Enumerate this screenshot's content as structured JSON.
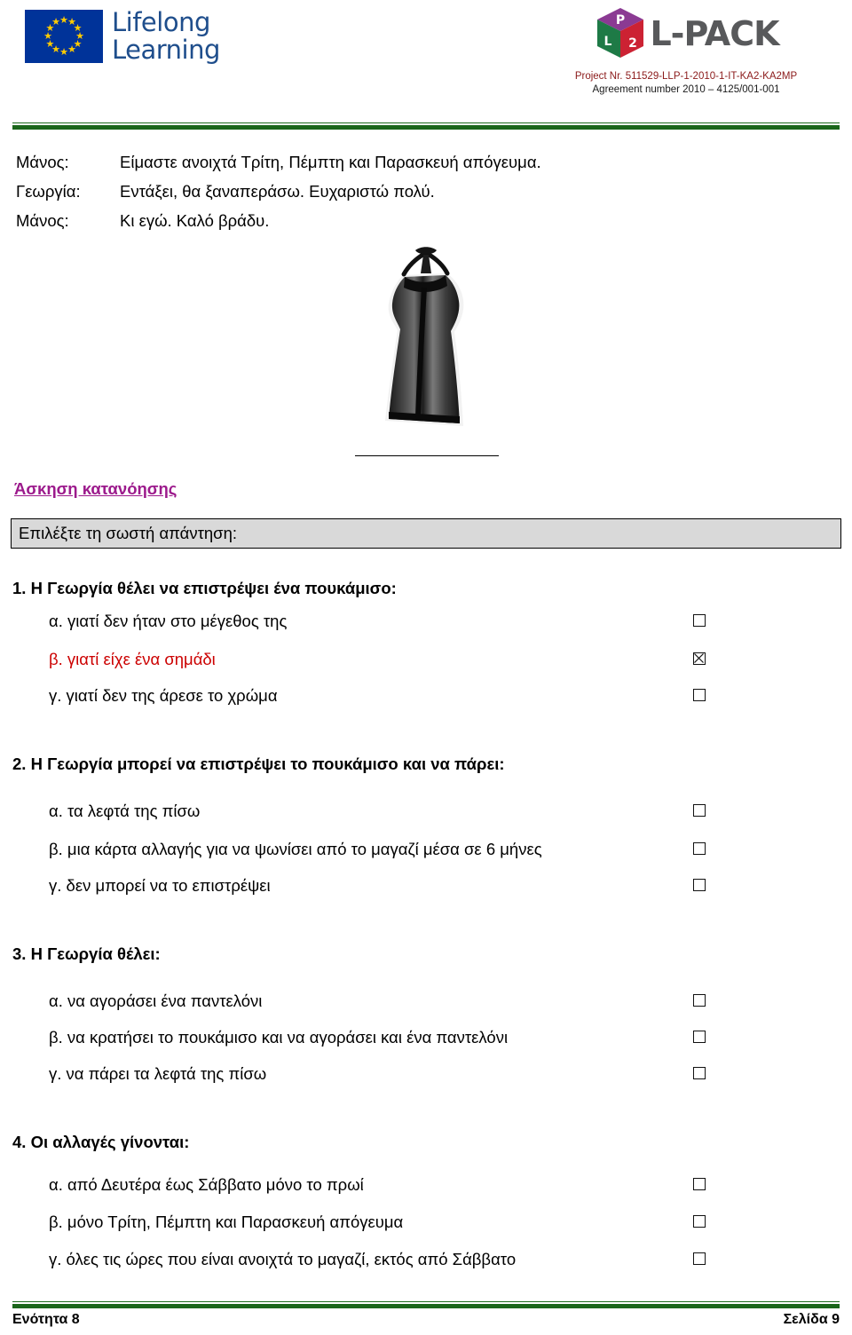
{
  "header": {
    "eu_logo_line1": "Lifelong",
    "eu_logo_line2": "Learning",
    "lpack_word": "L-PACK",
    "cube_top_letter": "P",
    "cube_left_letter": "L",
    "cube_right_letter": "2",
    "project_line1": "Project Nr. 511529-LLP-1-2010-1-IT-KA2-KA2MP",
    "project_line2": "Agreement number 2010 – 4125/001-001",
    "rule_color": "#1A661A"
  },
  "dialogue": [
    {
      "speaker": "Μάνος:",
      "text": "Είμαστε ανοιχτά Τρίτη, Πέμπτη και Παρασκευή απόγευμα."
    },
    {
      "speaker": "Γεωργία:",
      "text": "Εντάξει, θα ξαναπεράσω. Ευχαριστώ πολύ."
    },
    {
      "speaker": "Μάνος:",
      "text": "Κι εγώ. Καλό βράδυ."
    }
  ],
  "illustration": {
    "alt": "black-halter-dress"
  },
  "exercise": {
    "title": "Άσκηση κατανόησης",
    "title_color": "#9C1A8C",
    "instruction": "Επιλέξτε τη σωστή απάντηση:",
    "correct_color": "#CC0000"
  },
  "questions": [
    {
      "number": "1.",
      "title": "1. Η Γεωργία θέλει να επιστρέψει ένα πουκάμισο:",
      "options": [
        {
          "label": "α. γιατί δεν ήταν στο μέγεθος της",
          "checked": false,
          "correct": false
        },
        {
          "label": "β. γιατί είχε ένα σημάδι",
          "checked": true,
          "correct": true
        },
        {
          "label": "γ. γιατί δεν της άρεσε το χρώμα",
          "checked": false,
          "correct": false
        }
      ]
    },
    {
      "number": "2.",
      "title": "2. Η Γεωργία μπορεί να επιστρέψει το πουκάμισο και να πάρει:",
      "options": [
        {
          "label": "α. τα λεφτά της πίσω",
          "checked": false,
          "correct": false
        },
        {
          "label": "β. μια κάρτα αλλαγής για να ψωνίσει από το μαγαζί μέσα σε 6 μήνες",
          "checked": false,
          "correct": false
        },
        {
          "label": "γ. δεν μπορεί να το επιστρέψει",
          "checked": false,
          "correct": false
        }
      ]
    },
    {
      "number": "3.",
      "title": "3. Η Γεωργία θέλει:",
      "options": [
        {
          "label": "α. να αγοράσει ένα παντελόνι",
          "checked": false,
          "correct": false
        },
        {
          "label": "β. να κρατήσει το πουκάμισο και να αγοράσει και ένα παντελόνι",
          "checked": false,
          "correct": false
        },
        {
          "label": "γ. να πάρει τα λεφτά της πίσω",
          "checked": false,
          "correct": false
        }
      ]
    },
    {
      "number": "4.",
      "title": "4. Οι αλλαγές γίνονται:",
      "options": [
        {
          "label": "α. από Δευτέρα έως Σάββατο μόνο το πρωί",
          "checked": false,
          "correct": false
        },
        {
          "label": "β. μόνο Τρίτη, Πέμπτη και Παρασκευή απόγευμα",
          "checked": false,
          "correct": false
        },
        {
          "label": "γ.  όλες τις ώρες που είναι ανοιχτά το μαγαζί, εκτός από Σάββατο",
          "checked": false,
          "correct": false
        }
      ]
    }
  ],
  "footer": {
    "left": "Ενότητα 8",
    "right": "Σελίδα 9"
  }
}
